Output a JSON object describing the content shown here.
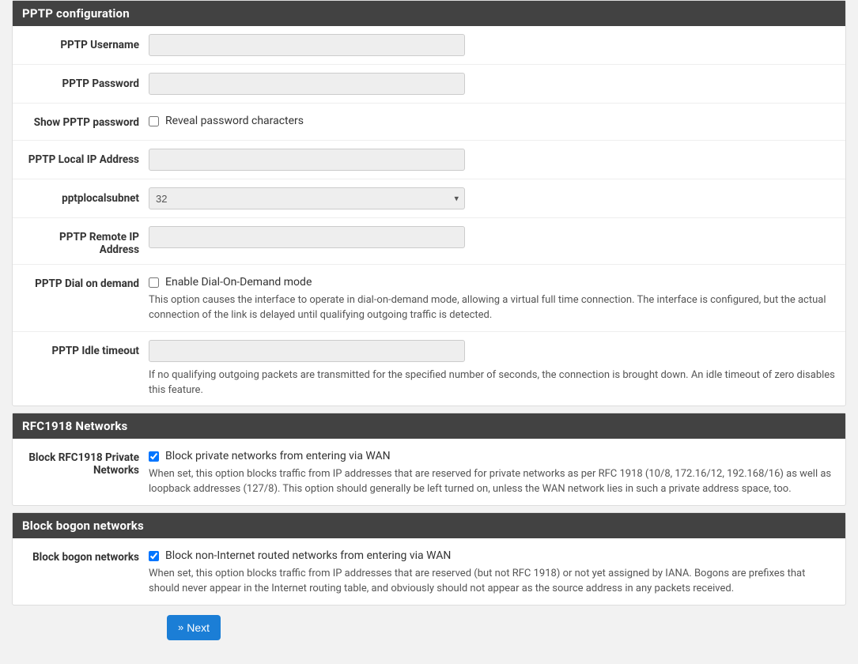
{
  "pptp": {
    "header": "PPTP configuration",
    "username_label": "PPTP Username",
    "username_value": "",
    "password_label": "PPTP Password",
    "password_value": "",
    "show_password_label": "Show PPTP password",
    "show_password_chk": "Reveal password characters",
    "local_ip_label": "PPTP Local IP Address",
    "local_ip_value": "",
    "subnet_label": "pptplocalsubnet",
    "subnet_value": "32",
    "remote_ip_label": "PPTP Remote IP Address",
    "remote_ip_value": "",
    "dod_label": "PPTP Dial on demand",
    "dod_chk": "Enable Dial-On-Demand mode",
    "dod_help": "This option causes the interface to operate in dial-on-demand mode, allowing a virtual full time connection. The interface is configured, but the actual connection of the link is delayed until qualifying outgoing traffic is detected.",
    "idle_label": "PPTP Idle timeout",
    "idle_value": "",
    "idle_help": "If no qualifying outgoing packets are transmitted for the specified number of seconds, the connection is brought down. An idle timeout of zero disables this feature."
  },
  "rfc1918": {
    "header": "RFC1918 Networks",
    "block_label": "Block RFC1918 Private Networks",
    "block_chk": "Block private networks from entering via WAN",
    "block_help": "When set, this option blocks traffic from IP addresses that are reserved for private networks as per RFC 1918 (10/8, 172.16/12, 192.168/16) as well as loopback addresses (127/8). This option should generally be left turned on, unless the WAN network lies in such a private address space, too."
  },
  "bogon": {
    "header": "Block bogon networks",
    "block_label": "Block bogon networks",
    "block_chk": "Block non-Internet routed networks from entering via WAN",
    "block_help": "When set, this option blocks traffic from IP addresses that are reserved (but not RFC 1918) or not yet assigned by IANA. Bogons are prefixes that should never appear in the Internet routing table, and obviously should not appear as the source address in any packets received."
  },
  "nav": {
    "next_label": "Next"
  }
}
